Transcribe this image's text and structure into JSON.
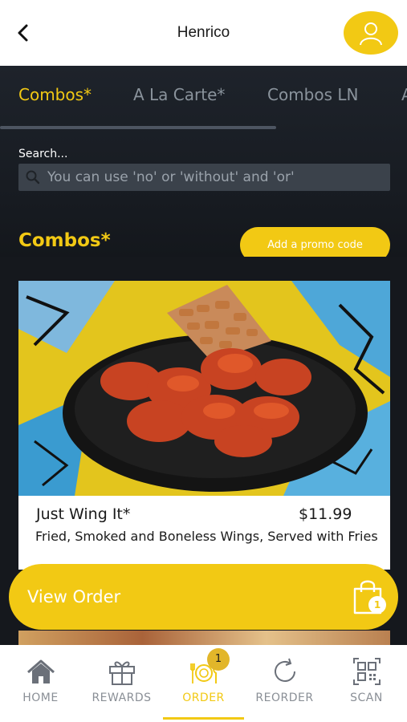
{
  "header": {
    "title": "Henrico"
  },
  "tabs": [
    {
      "label": "Combos*",
      "active": true
    },
    {
      "label": "A La Carte*",
      "active": false
    },
    {
      "label": "Combos LN",
      "active": false
    }
  ],
  "search": {
    "label": "Search...",
    "placeholder": "You can use 'no' or 'without' and 'or'"
  },
  "section": {
    "title": "Combos*",
    "promo_button": "Add a promo code"
  },
  "items": [
    {
      "name": "Just Wing It*",
      "price": "$11.99",
      "description": "Fried, Smoked and Boneless Wings, Served with Fries"
    }
  ],
  "cart": {
    "view_order_label": "View Order",
    "count": "1"
  },
  "bottom_nav": [
    {
      "label": "HOME",
      "icon": "home-icon",
      "active": false
    },
    {
      "label": "REWARDS",
      "icon": "gift-icon",
      "active": false
    },
    {
      "label": "ORDER",
      "icon": "plate-cutlery-icon",
      "active": true,
      "badge": "1"
    },
    {
      "label": "REORDER",
      "icon": "refresh-icon",
      "active": false
    },
    {
      "label": "SCAN",
      "icon": "qr-code-icon",
      "active": false
    }
  ],
  "colors": {
    "accent": "#f2c914",
    "dark_bg": "#1c1f24",
    "inactive": "#8a939c"
  }
}
